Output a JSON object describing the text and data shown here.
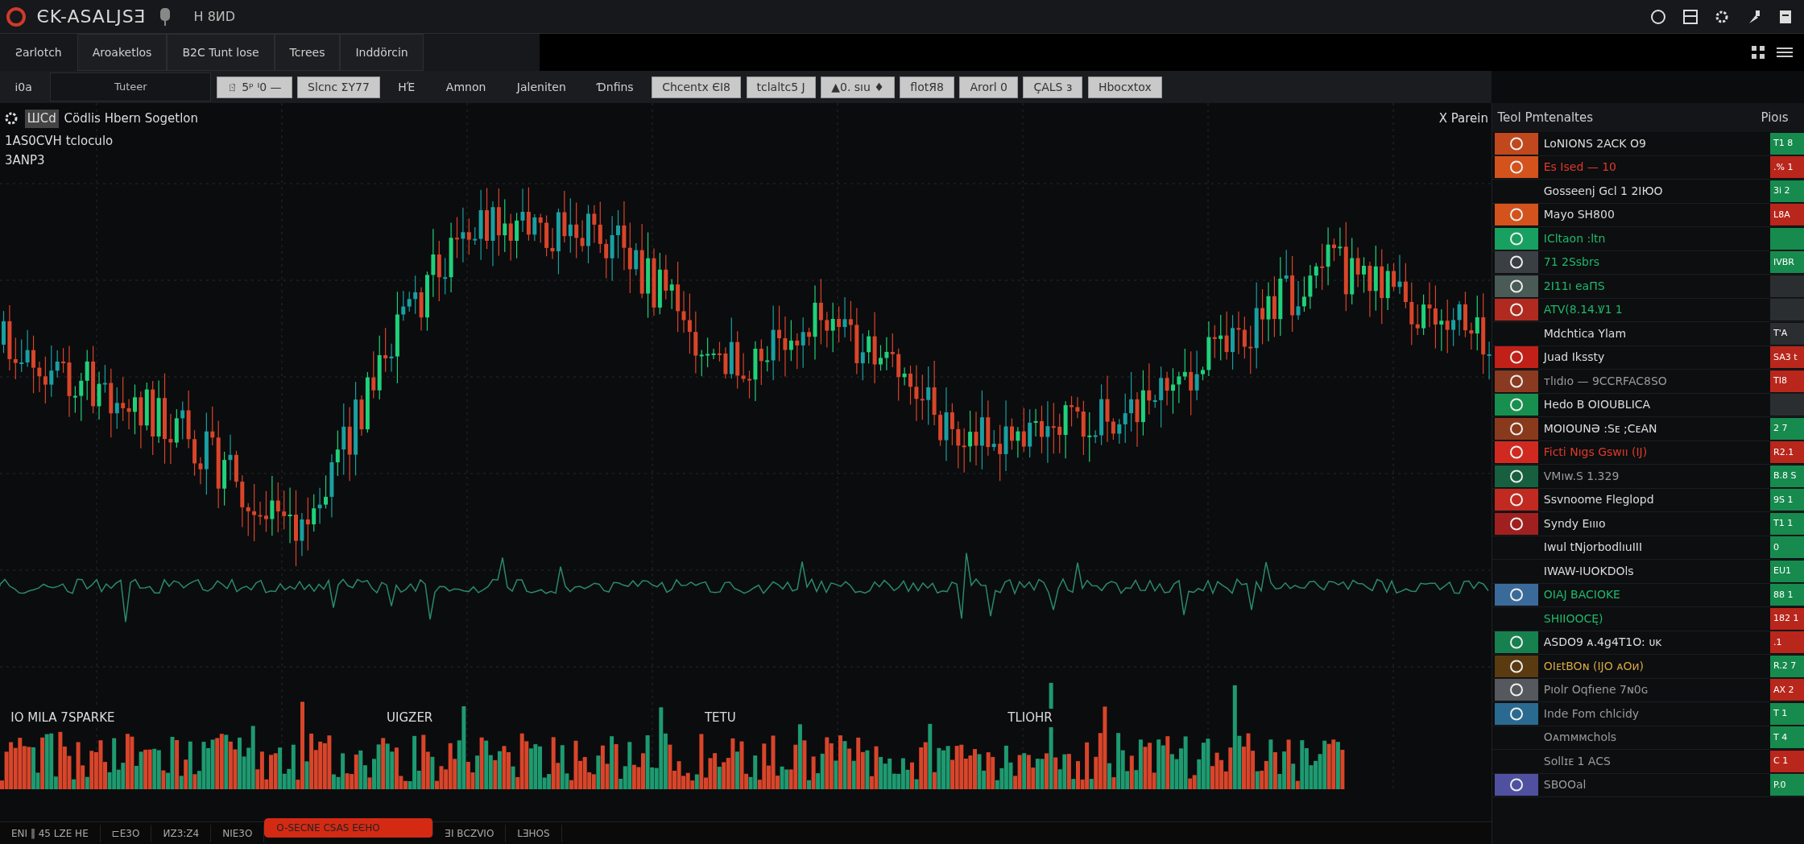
{
  "app": {
    "title": "ЄK-ASALJSƎ",
    "subtitle": "H 8ИD"
  },
  "tabs": [
    {
      "label": "Ƨarlotch",
      "selected": true
    },
    {
      "label": "Aroaketlos",
      "selected": false
    },
    {
      "label": "B2C Tunt lose",
      "selected": false
    },
    {
      "label": "Tcrees",
      "selected": false
    },
    {
      "label": "Inddörcin",
      "selected": false
    }
  ],
  "toolbar": [
    {
      "kind": "text",
      "label": "Ꭵ0a"
    },
    {
      "kind": "dropdown",
      "label": "Tuteer"
    },
    {
      "kind": "button",
      "label": "ㄖ 5ᵖ ᑊ0 —"
    },
    {
      "kind": "button",
      "label": "Slcnc ΣΥ77"
    },
    {
      "kind": "text",
      "label": "ΗΈ"
    },
    {
      "kind": "text",
      "label": "Amnon"
    },
    {
      "kind": "text",
      "label": "Jaleniten"
    },
    {
      "kind": "text",
      "label": "Ɗnfins"
    },
    {
      "kind": "button",
      "label": "Chcentx ЄI8"
    },
    {
      "kind": "button",
      "label": "tclaltc5 J"
    },
    {
      "kind": "button",
      "label": "▲0. sıu ♦"
    },
    {
      "kind": "button",
      "label": "flotЯ8"
    },
    {
      "kind": "button",
      "label": "Arorl 0"
    },
    {
      "kind": "button",
      "label": "ÇALS ɜ"
    },
    {
      "kind": "button",
      "label": "Hbocxtox"
    }
  ],
  "chart": {
    "badge": "ШCd",
    "title": "Cödlis Hbern Sogetlon",
    "subtitle": "1AS0CVH tcloculo",
    "code": "3ANP3",
    "close_label": "X Parein",
    "volume_labels": [
      "IO MILA 7SPARKE",
      "UIGZER",
      "TETU",
      "TLIOHR"
    ]
  },
  "panel": {
    "title": "Teol Pmtenaltes",
    "column": "Pioıs",
    "rows": [
      {
        "name": "LoNIONS 2ACK O9",
        "kind": "white",
        "color": "#c0481c",
        "gain": true,
        "value": "T1 8"
      },
      {
        "name": "Es Ised — 10",
        "kind": "red",
        "color": "#d4521c",
        "gain": false,
        "value": ".% 1"
      },
      {
        "name": "Gosseenj Gcl 1 2IЮO",
        "kind": "white",
        "gain": true,
        "value": "3i 2"
      },
      {
        "name": "Mayo SH800",
        "kind": "white",
        "color": "#d4521c",
        "gain": false,
        "value": "L8A"
      },
      {
        "name": "ICltaon :ltn",
        "kind": "green",
        "color": "#17a060",
        "gain": true
      },
      {
        "name": "71 2Ssbrs",
        "kind": "green",
        "color": "#3a3f44",
        "gain": true,
        "value": "IVBR"
      },
      {
        "name": "2I11ı eaПS",
        "kind": "green",
        "color": "#4a5a55"
      },
      {
        "name": "ATV(8.14.Ꝟ1 1",
        "kind": "green",
        "color": "#b02a20"
      },
      {
        "name": "Mdchtica Ylam",
        "kind": "white",
        "value": "T'A"
      },
      {
        "name": "Juad Ikssty",
        "kind": "white",
        "color": "#c02018",
        "gain": false,
        "value": "SA3 t"
      },
      {
        "name": "ᴛlıdıo — 9CCRFAC8SO",
        "kind": "grey",
        "color": "#8a3a20",
        "gain": false,
        "value": "TI8"
      },
      {
        "name": "Hedo B OIOUBLICA",
        "kind": "white",
        "color": "#17904f"
      },
      {
        "name": "MOIOUNƏ :Sᴇ ;CᴇAN",
        "kind": "white",
        "color": "#8a3a1c",
        "gain": true,
        "value": "2 7"
      },
      {
        "name": "Ficti Nıgs Gswıı (IJ)",
        "kind": "red",
        "color": "#d02a20",
        "gain": false,
        "value": "R2.1"
      },
      {
        "name": "VMıw.S 1.329",
        "kind": "grey",
        "color": "#17603f",
        "gain": true,
        "value": "B.8 S"
      },
      {
        "name": "Ssvnoome Flegloрd",
        "kind": "white",
        "color": "#c02a20",
        "gain": true,
        "value": "9S 1"
      },
      {
        "name": "Syndy Eıııo",
        "kind": "white",
        "color": "#a02020",
        "gain": true,
        "value": "T1 1"
      },
      {
        "name": "Iwul tNjorbodlıuIII",
        "kind": "white",
        "gain": true,
        "value": "0"
      },
      {
        "name": "IWAW-IUOKDOls",
        "kind": "white",
        "gain": true,
        "value": "EU1"
      },
      {
        "name": "OIAJ BACIOKE",
        "kind": "green",
        "color": "#3a6a9a",
        "gain": true,
        "value": "88 1"
      },
      {
        "name": "SHIIOOCĘ)",
        "kind": "green",
        "gain": false,
        "value": "182 1"
      },
      {
        "name": "ASDO9 ᴀ.4g4T1O: ᴜᴋ",
        "kind": "white",
        "color": "#17804f",
        "gain": false,
        "value": ".1"
      },
      {
        "name": "OIᴇtBOɴ (IJO ᴀOᴎ)",
        "kind": "gold",
        "color": "#5a3a10",
        "gain": true,
        "value": "R.2 7"
      },
      {
        "name": "Pıolr Oqfıene 7ɴ0ɢ",
        "kind": "grey",
        "color": "#55585c",
        "gain": false,
        "value": "AX 2"
      },
      {
        "name": "Inde Fom chlcidy",
        "kind": "grey",
        "color": "#2a6a90",
        "gain": true,
        "value": "T 1"
      },
      {
        "name": "Oᴀmᴍᴍchols",
        "kind": "grey",
        "gain": true,
        "value": "T 4"
      },
      {
        "name": "Sᴏllɪᴇ 1 ACS",
        "kind": "grey",
        "gain": false,
        "value": "C 1"
      },
      {
        "name": "SBOOal",
        "kind": "grey",
        "color": "#5050a0",
        "gain": true,
        "value": "P.0"
      }
    ]
  },
  "status_bar": [
    {
      "label": "ЕNI ‖ 45 LZE HE",
      "alert": false
    },
    {
      "label": "⊏E3O",
      "alert": false
    },
    {
      "label": "ИZ3:Z4",
      "alert": false
    },
    {
      "label": "NIE3O",
      "alert": false
    },
    {
      "label": "O-SEСNE CSAS EЄHO",
      "alert": true
    },
    {
      "label": "ƎI ВCZVIO",
      "alert": false
    },
    {
      "label": "LƎHOS",
      "alert": false
    }
  ]
}
